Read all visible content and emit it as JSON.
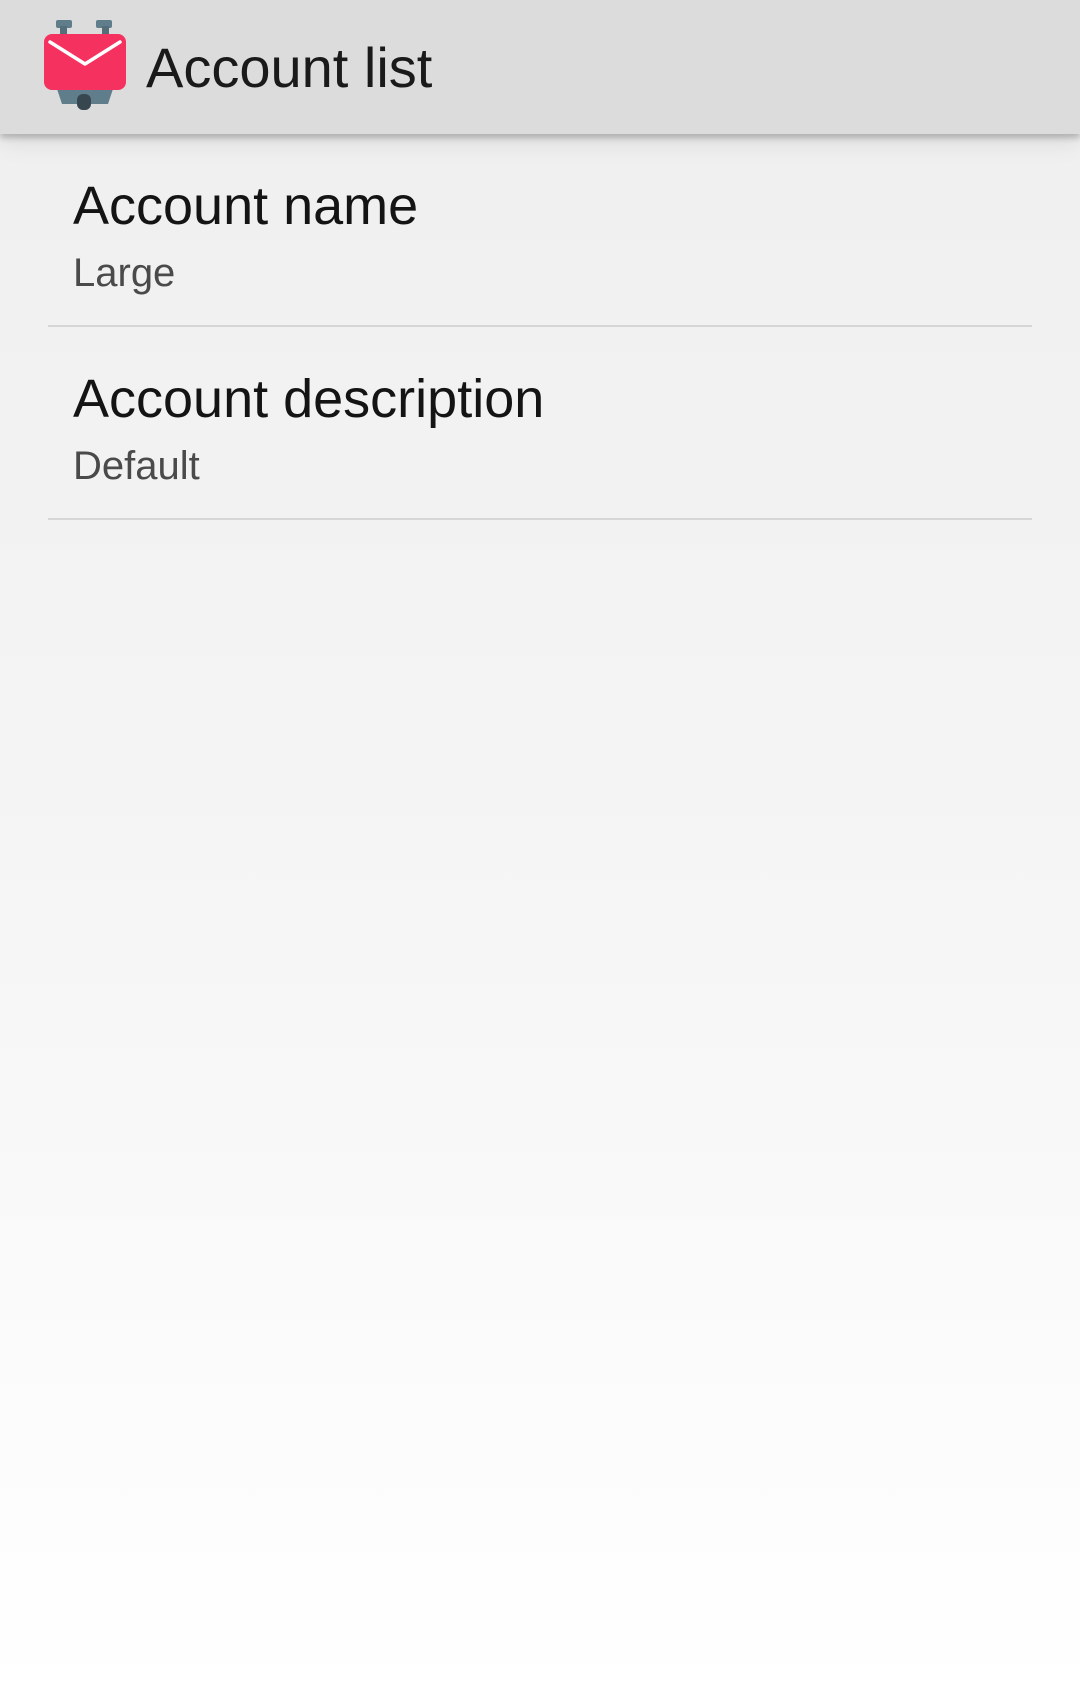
{
  "toolbar": {
    "title": "Account list",
    "app_icon": "k9-mail-envelope-icon"
  },
  "preferences": [
    {
      "title": "Account name",
      "summary": "Large"
    },
    {
      "title": "Account description",
      "summary": "Default"
    }
  ],
  "colors": {
    "toolbar_background": "#dcdcdc",
    "icon_envelope": "#f5325f",
    "icon_body": "#607d8b"
  }
}
